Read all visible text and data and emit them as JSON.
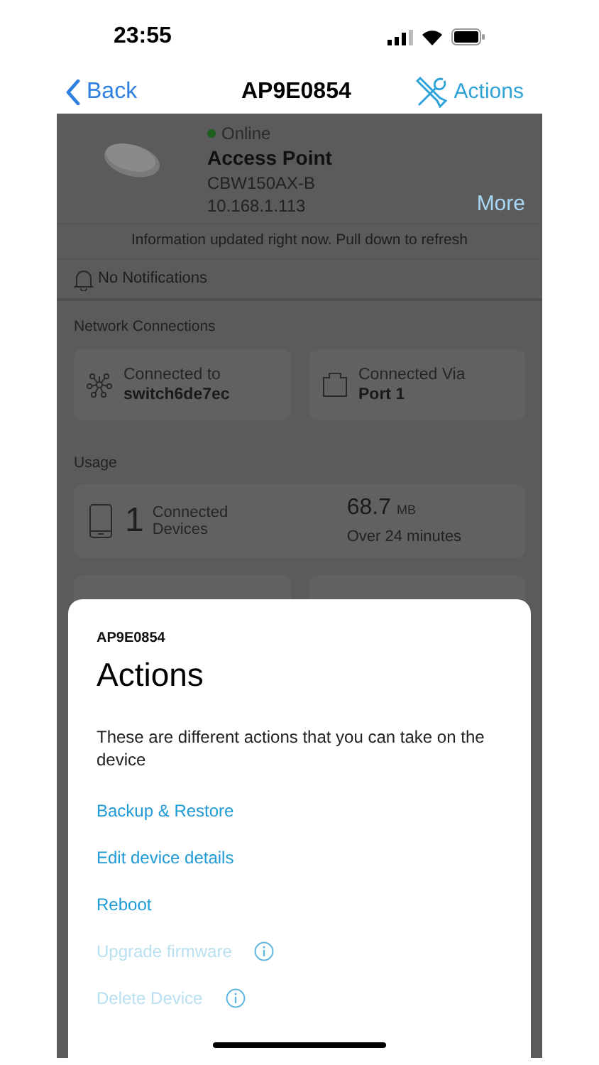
{
  "status_bar": {
    "time": "23:55"
  },
  "nav": {
    "back": "Back",
    "title": "AP9E0854",
    "actions": "Actions"
  },
  "device": {
    "status": "Online",
    "online": true,
    "name": "Access Point",
    "model": "CBW150AX-B",
    "ip": "10.168.1.113",
    "more": "More"
  },
  "info": "Information updated right now. Pull down to refresh",
  "notifications": "No Notifications",
  "network_connections": {
    "title": "Network Connections",
    "cards": [
      {
        "kind": "switch",
        "label": "Connected to",
        "value": "switch6de7ec"
      },
      {
        "kind": "port",
        "label": "Connected Via",
        "value": "Port 1"
      }
    ]
  },
  "usage": {
    "title": "Usage",
    "count": "1",
    "count_label": "Connected Devices",
    "amount": "68.7",
    "unit": "MB",
    "period": "Over 24 minutes"
  },
  "sheet": {
    "subtitle": "AP9E0854",
    "title": "Actions",
    "description": "These are different actions that you can take on the device",
    "actions": [
      {
        "label": "Backup & Restore",
        "disabled": false,
        "info": false
      },
      {
        "label": "Edit device details",
        "disabled": false,
        "info": false
      },
      {
        "label": "Reboot",
        "disabled": false,
        "info": false
      },
      {
        "label": "Upgrade firmware",
        "disabled": true,
        "info": true
      },
      {
        "label": "Delete Device",
        "disabled": true,
        "info": true
      }
    ]
  }
}
